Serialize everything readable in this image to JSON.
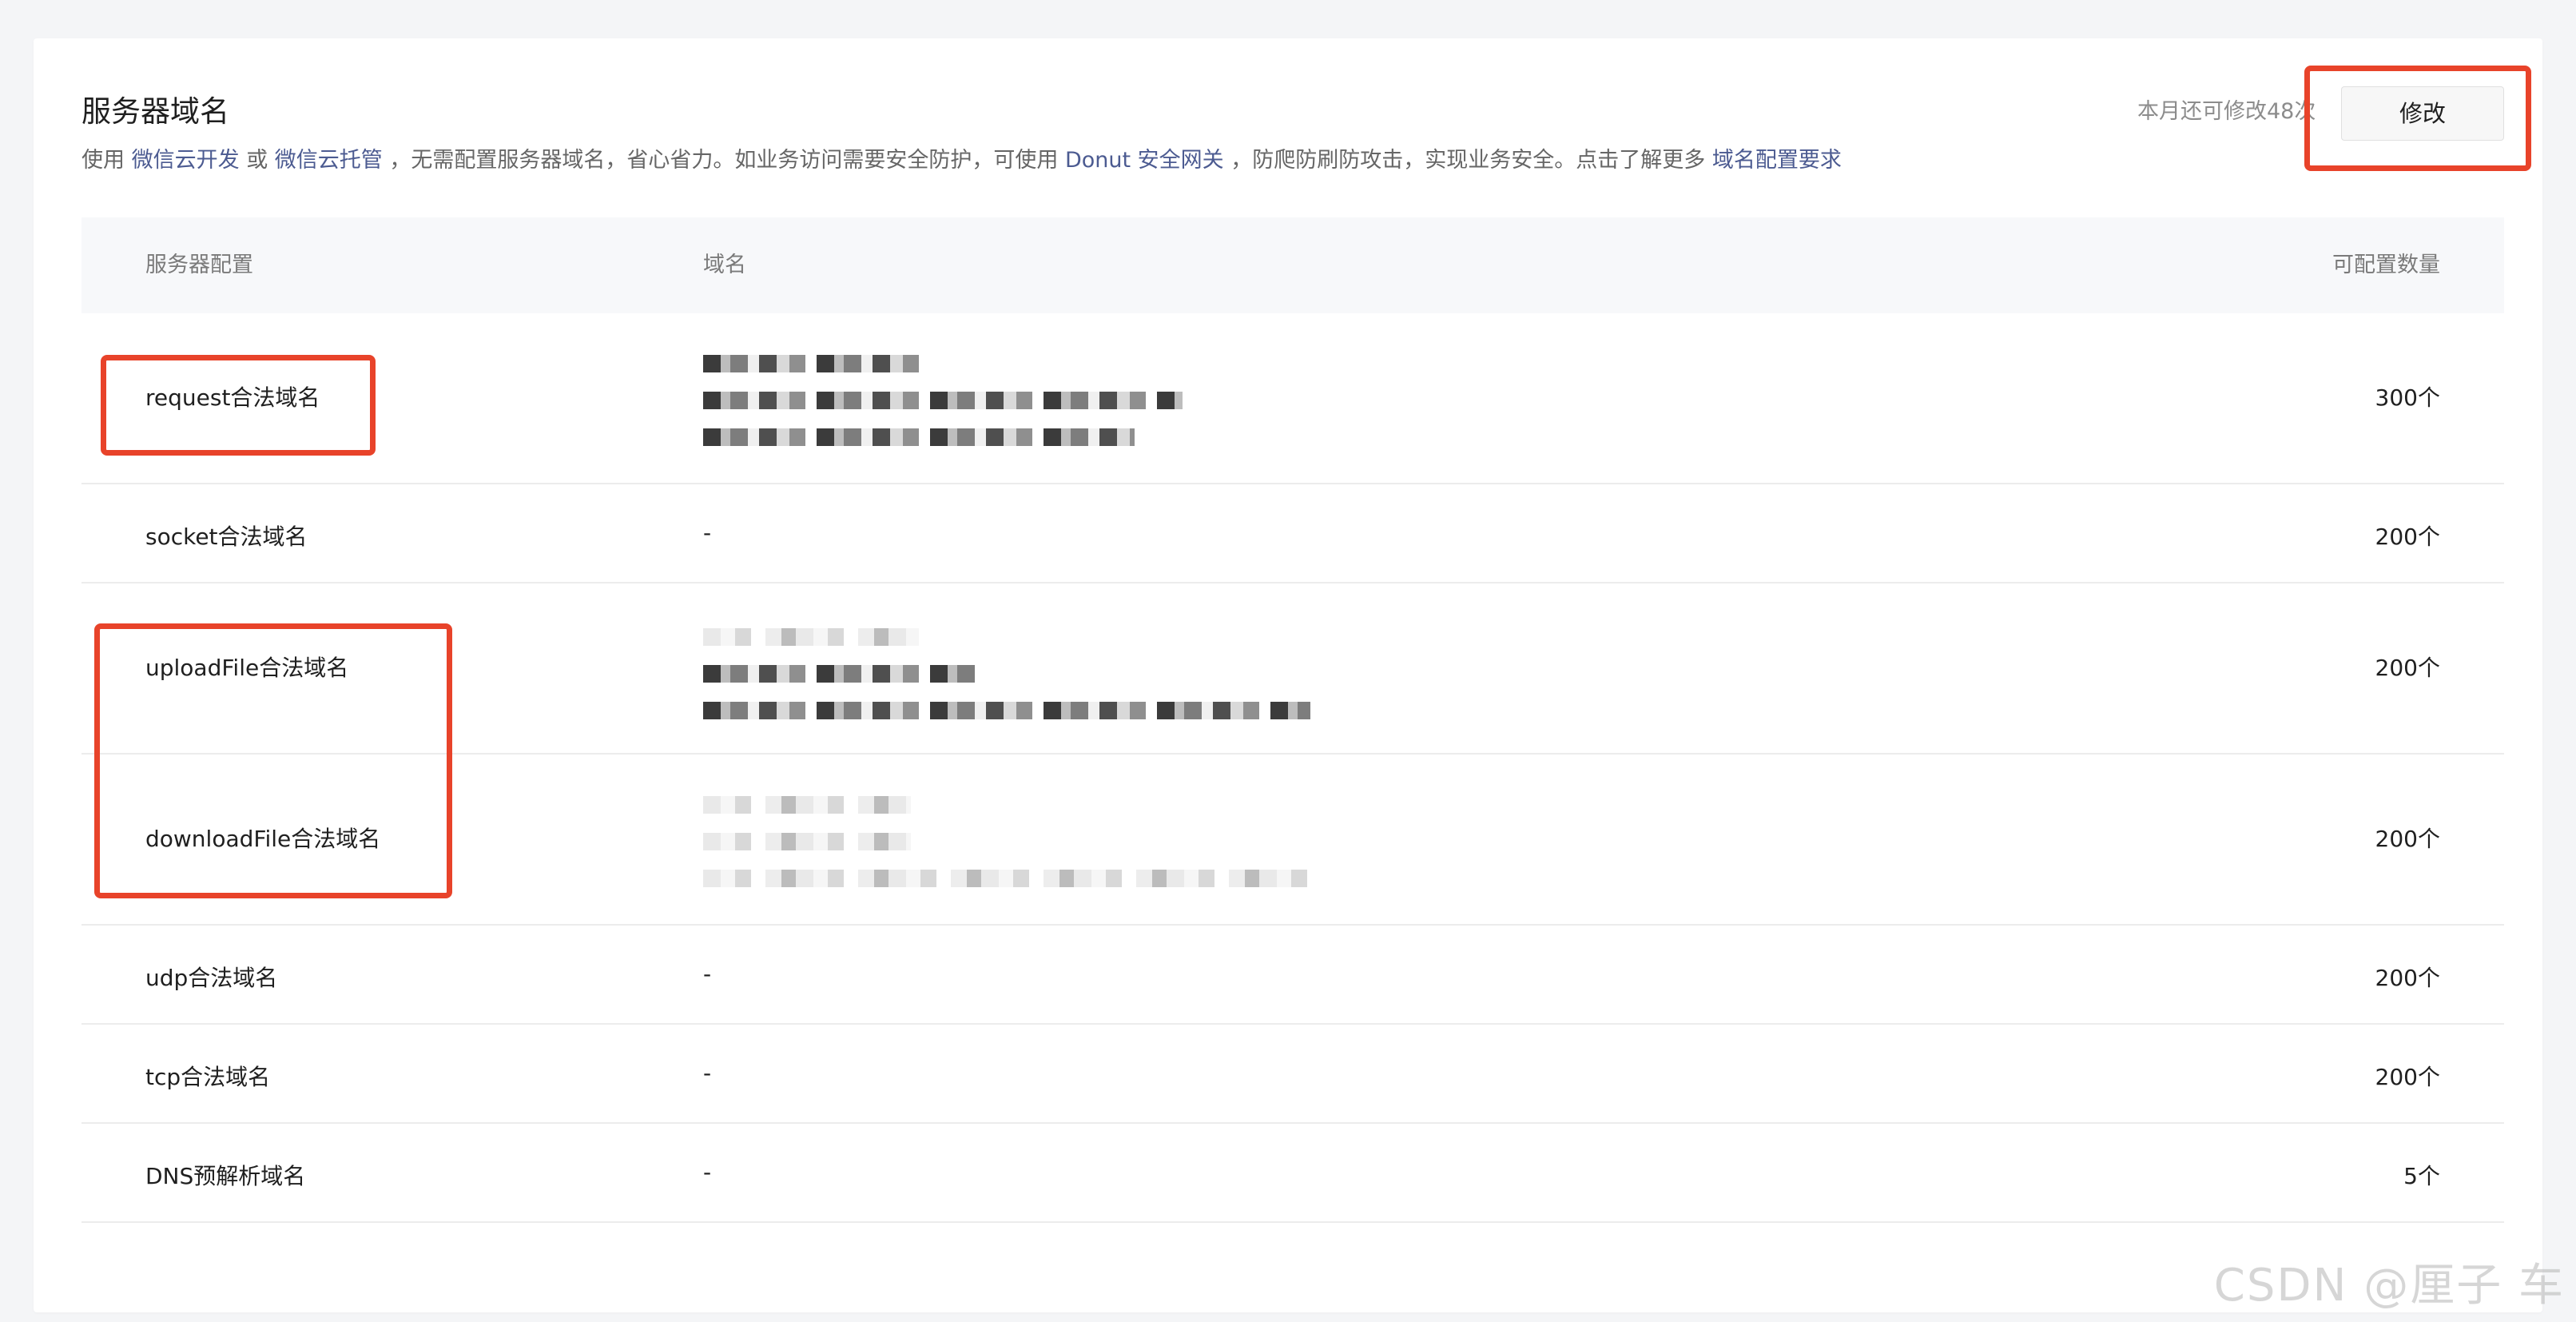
{
  "section": {
    "title": "服务器域名",
    "desc_prefix": "使用",
    "link_wechat_dev": "微信云开发",
    "desc_or": "或",
    "link_wechat_host": "微信云托管",
    "desc_middle": "，无需配置服务器域名，省心省力。如业务访问需要安全防护，可使用",
    "link_donut": "Donut 安全网关",
    "desc_tail": "，防爬防刷防攻击，实现业务安全。点击了解更多",
    "link_requirements": "域名配置要求"
  },
  "quota": {
    "note": "本月还可修改48次",
    "modify_label": "修改"
  },
  "table": {
    "headers": {
      "config": "服务器配置",
      "domain": "域名",
      "count": "可配置数量"
    },
    "rows": [
      {
        "config": "request合法域名",
        "domain": "",
        "count": "300个"
      },
      {
        "config": "socket合法域名",
        "domain": "-",
        "count": "200个"
      },
      {
        "config": "uploadFile合法域名",
        "domain": "",
        "count": "200个"
      },
      {
        "config": "downloadFile合法域名",
        "domain": "",
        "count": "200个"
      },
      {
        "config": "udp合法域名",
        "domain": "-",
        "count": "200个"
      },
      {
        "config": "tcp合法域名",
        "domain": "-",
        "count": "200个"
      },
      {
        "config": "DNS预解析域名",
        "domain": "-",
        "count": "5个"
      }
    ]
  },
  "watermark": "CSDN @厘子 车",
  "colors": {
    "link": "#4c5b91",
    "annotation": "#e8432a",
    "header_bg": "#f7f8fa"
  }
}
